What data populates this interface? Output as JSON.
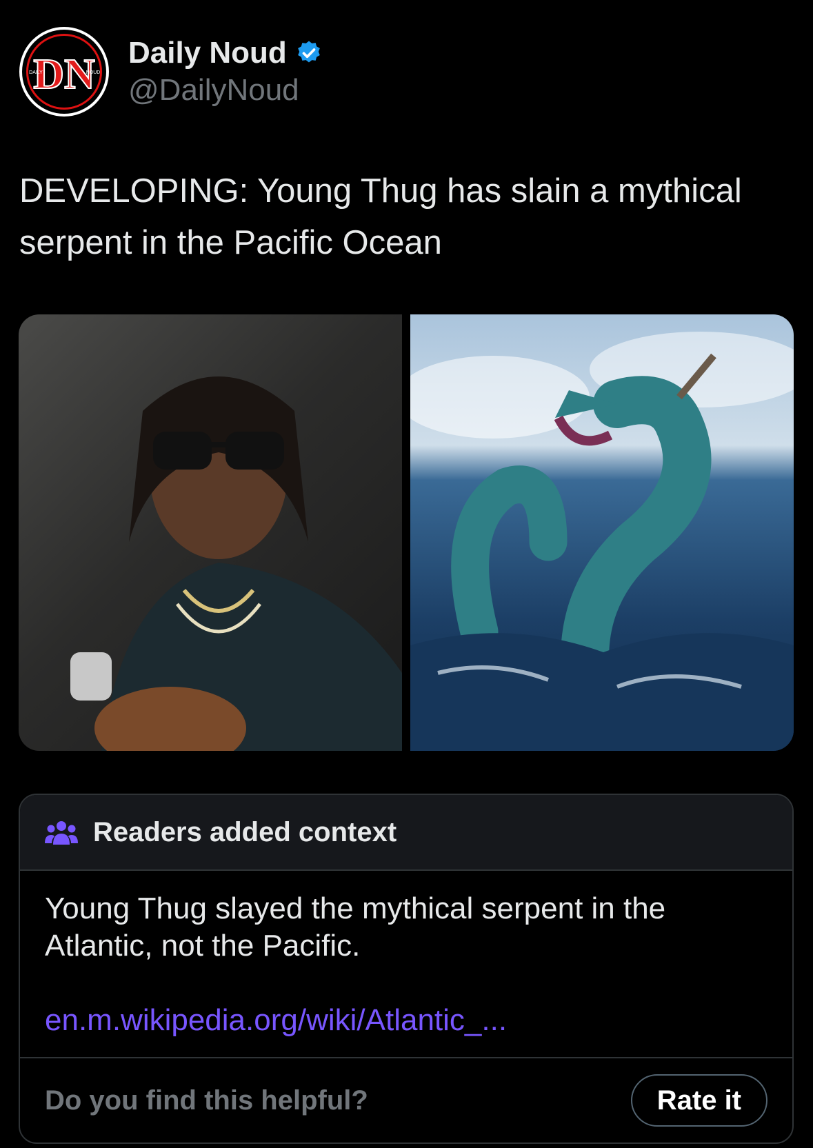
{
  "account": {
    "display_name": "Daily Noud",
    "handle": "@DailyNoud",
    "avatar_text": "DN",
    "verified_icon": "verified-badge-icon"
  },
  "tweet": {
    "text": "DEVELOPING: Young Thug has slain a mythical serpent in the Pacific Ocean"
  },
  "media": [
    {
      "icon": "photo-person"
    },
    {
      "icon": "photo-sea-serpent"
    }
  ],
  "community_note": {
    "title": "Readers added context",
    "body": "Young Thug slayed the mythical serpent in the Atlantic, not the Pacific.",
    "link": "en.m.wikipedia.org/wiki/Atlantic_...",
    "prompt": "Do you find this helpful?",
    "rate_label": "Rate it",
    "accent": "#7856ff"
  }
}
